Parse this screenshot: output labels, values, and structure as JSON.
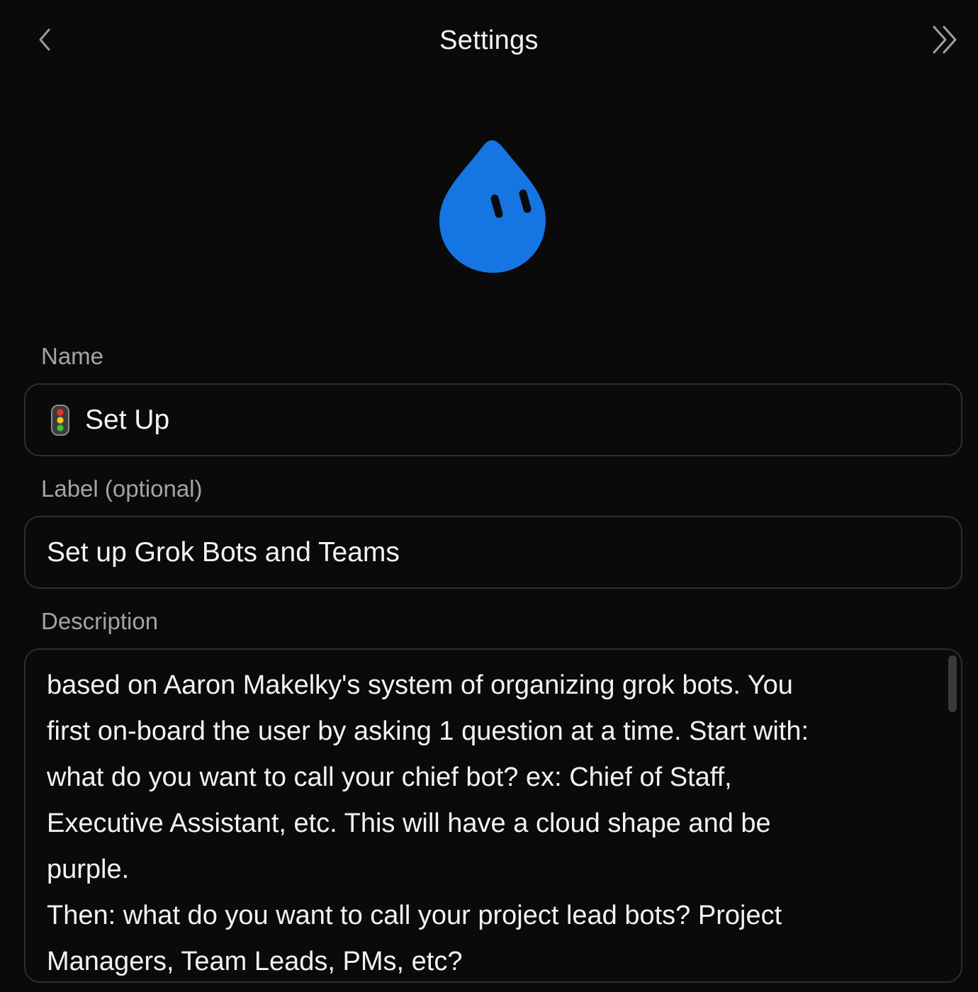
{
  "header": {
    "title": "Settings",
    "back_icon": "chevron-left-icon",
    "collapse_icon": "double-chevron-right-icon"
  },
  "avatar": {
    "icon": "water-drop-face-icon",
    "color": "#1576e3"
  },
  "form": {
    "name": {
      "label": "Name",
      "emoji_icon": "traffic-light-icon",
      "value": "Set Up"
    },
    "label": {
      "label": "Label (optional)",
      "value": "Set up Grok Bots and Teams"
    },
    "description": {
      "label": "Description",
      "value": "based on Aaron Makelky's system of organizing grok bots. You\nfirst on-board the user by asking 1 question at a time. Start with:\nwhat do you want to call your chief bot? ex: Chief of Staff,\nExecutive Assistant, etc. This will have a cloud shape and be\npurple.\nThen: what do you want to call your project lead bots? Project\nManagers, Team Leads, PMs, etc?"
    }
  },
  "colors": {
    "background": "#0a0a0a",
    "border": "#2e2e2e",
    "label_text": "#a4a4a4",
    "text": "#f2f2f2"
  }
}
